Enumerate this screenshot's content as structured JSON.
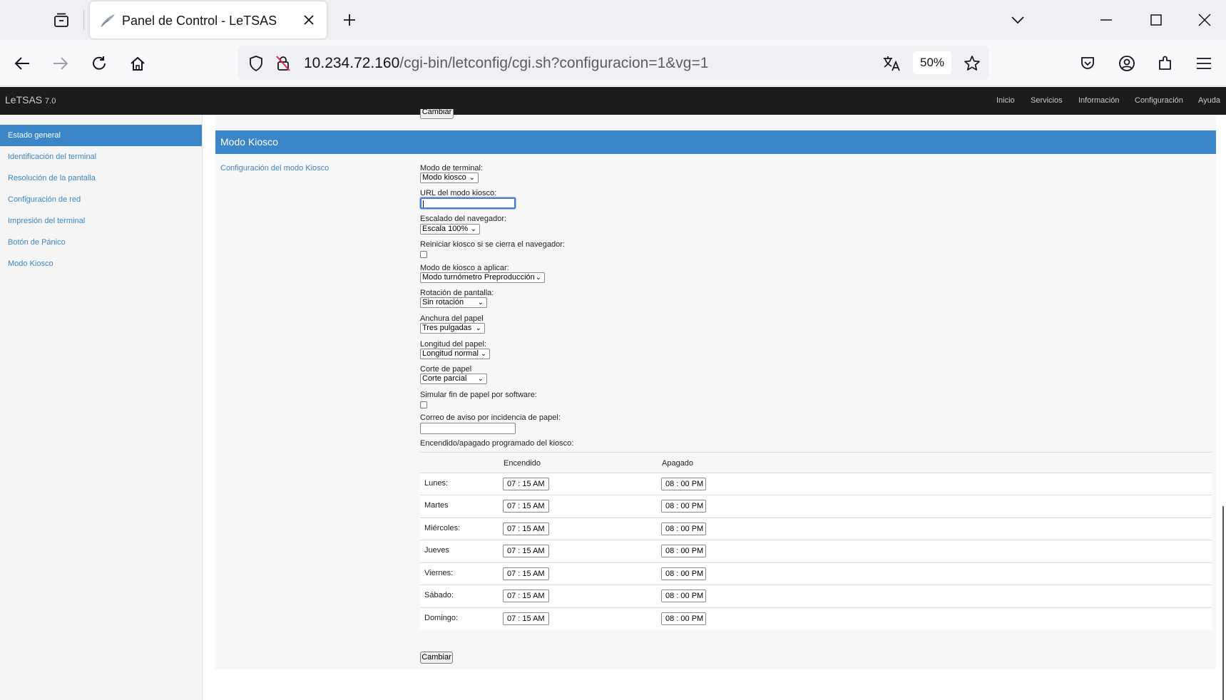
{
  "browser": {
    "tab_title": "Panel de Control - LeTSAS",
    "url_host": "10.234.72.160",
    "url_path": "/cgi-bin/letconfig/cgi.sh?configuracion=1&vg=1",
    "zoom": "50%"
  },
  "app": {
    "brand": "LeTSAS",
    "version": "7.0",
    "nav": [
      "Inicio",
      "Servicios",
      "Información",
      "Configuración",
      "Ayuda"
    ]
  },
  "sidebar": {
    "items": [
      "Estado general",
      "Identificación del terminal",
      "Resolución de la pantalla",
      "Configuración de red",
      "Impresión del terminal",
      "Botón de Pánico",
      "Modo Kiosco"
    ]
  },
  "section": {
    "title": "Modo Kiosco",
    "subtitle": "Configuración del modo Kiosco",
    "top_button": "Cambiar"
  },
  "form": {
    "terminal_mode_label": "Modo de terminal:",
    "terminal_mode_value": "Modo kiosco",
    "url_label": "URL del modo kiosco:",
    "url_value": "",
    "scale_label": "Escalado del navegador:",
    "scale_value": "Escala 100%",
    "restart_label": "Reiniciar kiosco si se cierra el navegador:",
    "kiosk_mode_label": "Modo de kiosco a aplicar:",
    "kiosk_mode_value": "Modo turnómetro Preproducción",
    "rotation_label": "Rotación de pantalla:",
    "rotation_value": "Sin rotación",
    "paper_width_label": "Anchura del papel",
    "paper_width_value": "Tres pulgadas",
    "paper_length_label": "Longitud del papel:",
    "paper_length_value": "Longitud normal",
    "paper_cut_label": "Corte de papel",
    "paper_cut_value": "Corte parcial",
    "simulate_label": "Simular fin de papel por software:",
    "email_label": "Correo de aviso por incidencia de papel:",
    "email_value": "",
    "schedule_label": "Encendido/apagado programado del kiosco:",
    "submit": "Cambiar"
  },
  "schedule": {
    "col_on": "Encendido",
    "col_off": "Apagado",
    "rows": [
      {
        "day": "Lunes:",
        "on": "07 : 15  AM",
        "off": "08 : 00  PM"
      },
      {
        "day": "Martes",
        "on": "07 : 15  AM",
        "off": "08 : 00  PM"
      },
      {
        "day": "Miércoles:",
        "on": "07 : 15  AM",
        "off": "08 : 00  PM"
      },
      {
        "day": "Jueves",
        "on": "07 : 15  AM",
        "off": "08 : 00  PM"
      },
      {
        "day": "Viernes:",
        "on": "07 : 15  AM",
        "off": "08 : 00  PM"
      },
      {
        "day": "Sábado:",
        "on": "07 : 15  AM",
        "off": "08 : 00  PM"
      },
      {
        "day": "Domingo:",
        "on": "07 : 15  AM",
        "off": "08 : 00  PM"
      }
    ]
  }
}
